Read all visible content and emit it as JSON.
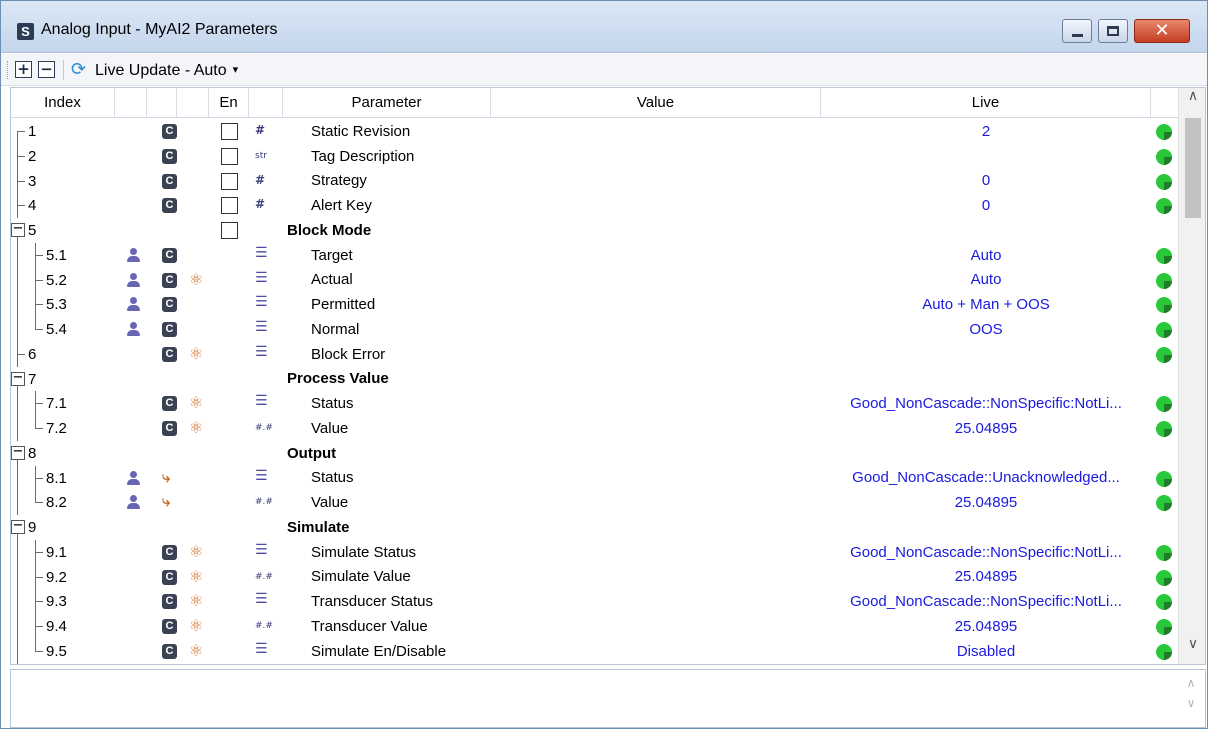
{
  "window": {
    "title": "Analog Input -  MyAI2 Parameters",
    "app_icon_letter": "S",
    "close_glyph": "✕"
  },
  "toolbar": {
    "expand_glyph": "+",
    "collapse_glyph": "−",
    "live_update_label": "Live Update - Auto",
    "caret": "▾"
  },
  "columns": {
    "index": "Index",
    "en": "En",
    "parameter": "Parameter",
    "value": "Value",
    "live": "Live"
  },
  "icons": {
    "c_letter": "C",
    "hash": "#",
    "hash_float": "#.#",
    "string": "str",
    "list": "☰",
    "atom": "⚛",
    "fork": "⤷"
  },
  "rows": [
    {
      "index": "1",
      "param": "Static Revision",
      "live": "2"
    },
    {
      "index": "2",
      "param": "Tag Description",
      "live": ""
    },
    {
      "index": "3",
      "param": "Strategy",
      "live": "0"
    },
    {
      "index": "4",
      "param": "Alert Key",
      "live": "0"
    },
    {
      "index": "5",
      "param": "Block Mode",
      "live": ""
    },
    {
      "index": "5.1",
      "param": "Target",
      "live": "Auto"
    },
    {
      "index": "5.2",
      "param": "Actual",
      "live": "Auto"
    },
    {
      "index": "5.3",
      "param": "Permitted",
      "live": "Auto + Man + OOS"
    },
    {
      "index": "5.4",
      "param": "Normal",
      "live": "OOS"
    },
    {
      "index": "6",
      "param": "Block Error",
      "live": ""
    },
    {
      "index": "7",
      "param": "Process Value",
      "live": ""
    },
    {
      "index": "7.1",
      "param": "Status",
      "live": "Good_NonCascade::NonSpecific:NotLi..."
    },
    {
      "index": "7.2",
      "param": "Value",
      "live": "25.04895"
    },
    {
      "index": "8",
      "param": "Output",
      "live": ""
    },
    {
      "index": "8.1",
      "param": "Status",
      "live": "Good_NonCascade::Unacknowledged..."
    },
    {
      "index": "8.2",
      "param": "Value",
      "live": "25.04895"
    },
    {
      "index": "9",
      "param": "Simulate",
      "live": ""
    },
    {
      "index": "9.1",
      "param": "Simulate Status",
      "live": "Good_NonCascade::NonSpecific:NotLi..."
    },
    {
      "index": "9.2",
      "param": "Simulate Value",
      "live": "25.04895"
    },
    {
      "index": "9.3",
      "param": "Transducer Status",
      "live": "Good_NonCascade::NonSpecific:NotLi..."
    },
    {
      "index": "9.4",
      "param": "Transducer Value",
      "live": "25.04895"
    },
    {
      "index": "9.5",
      "param": "Simulate En/Disable",
      "live": "Disabled"
    }
  ],
  "scroll": {
    "up": "∧",
    "down": "∨"
  },
  "colors": {
    "live_text": "#1a1ae0",
    "status_dot": "#28c83a",
    "icon_orange": "#d8742a"
  }
}
